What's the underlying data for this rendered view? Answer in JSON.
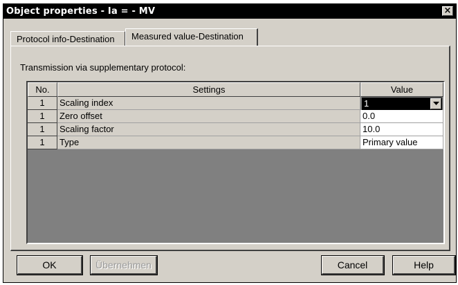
{
  "window": {
    "title": "Object properties - Ia  = - MV",
    "close_glyph": "×"
  },
  "tabs": [
    {
      "label": "Protocol info-Destination",
      "active": false
    },
    {
      "label": "Measured value-Destination",
      "active": true
    }
  ],
  "panel": {
    "label": "Transmission via supplementary protocol:"
  },
  "grid": {
    "headers": {
      "no": "No.",
      "settings": "Settings",
      "value": "Value"
    },
    "rows": [
      {
        "no": "1",
        "setting": "Scaling index",
        "value": "1"
      },
      {
        "no": "1",
        "setting": "Zero offset",
        "value": "0.0"
      },
      {
        "no": "1",
        "setting": "Scaling factor",
        "value": "10.0"
      },
      {
        "no": "1",
        "setting": "Type",
        "value": "Primary value"
      }
    ]
  },
  "buttons": {
    "ok": "OK",
    "apply": "Übernehmen",
    "cancel": "Cancel",
    "help": "Help"
  }
}
